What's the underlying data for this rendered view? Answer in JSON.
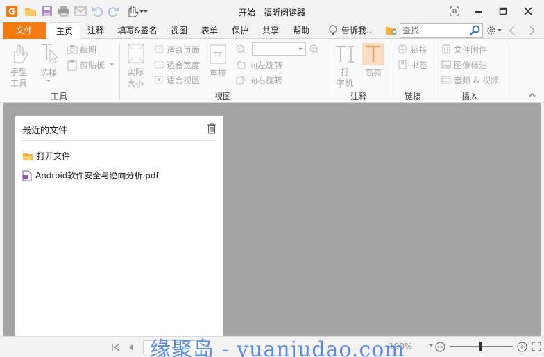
{
  "app": {
    "title": "开始 - 福昕阅读器"
  },
  "tabs": [
    "文件",
    "主页",
    "注释",
    "填写&签名",
    "视图",
    "表单",
    "保护",
    "共享",
    "帮助"
  ],
  "tellme": "告诉我...",
  "search": {
    "placeholder": "查找"
  },
  "ribbon": {
    "tools": {
      "hand": "手型\n工具",
      "select": "选择",
      "snapshot": "截图",
      "clipboard": "剪贴板",
      "group": "工具"
    },
    "view": {
      "actual": "实际\n大小",
      "fitpage": "适合页面",
      "fitwidth": "适合宽度",
      "fitvisible": "适合视区",
      "reflow": "重排",
      "rotleft": "向左旋转",
      "rotright": "向右旋转",
      "group": "视图"
    },
    "comment": {
      "typewriter": "打\n字机",
      "highlight": "高亮",
      "group": "注释"
    },
    "links": {
      "link": "链接",
      "bookmark": "书签",
      "group": "链接"
    },
    "insert": {
      "attach": "文件附件",
      "imageann": "图像标注",
      "av": "音频 & 视频",
      "group": "插入"
    }
  },
  "recent": {
    "title": "最近的文件",
    "open": "打开文件",
    "file": "Android软件安全与逆向分析.pdf"
  },
  "status": {
    "zoom": "100%"
  },
  "watermark": "缘聚岛 - yuanjudao.com",
  "colors": {
    "accent": "#f57a10",
    "workspace": "#a3a3a3"
  }
}
